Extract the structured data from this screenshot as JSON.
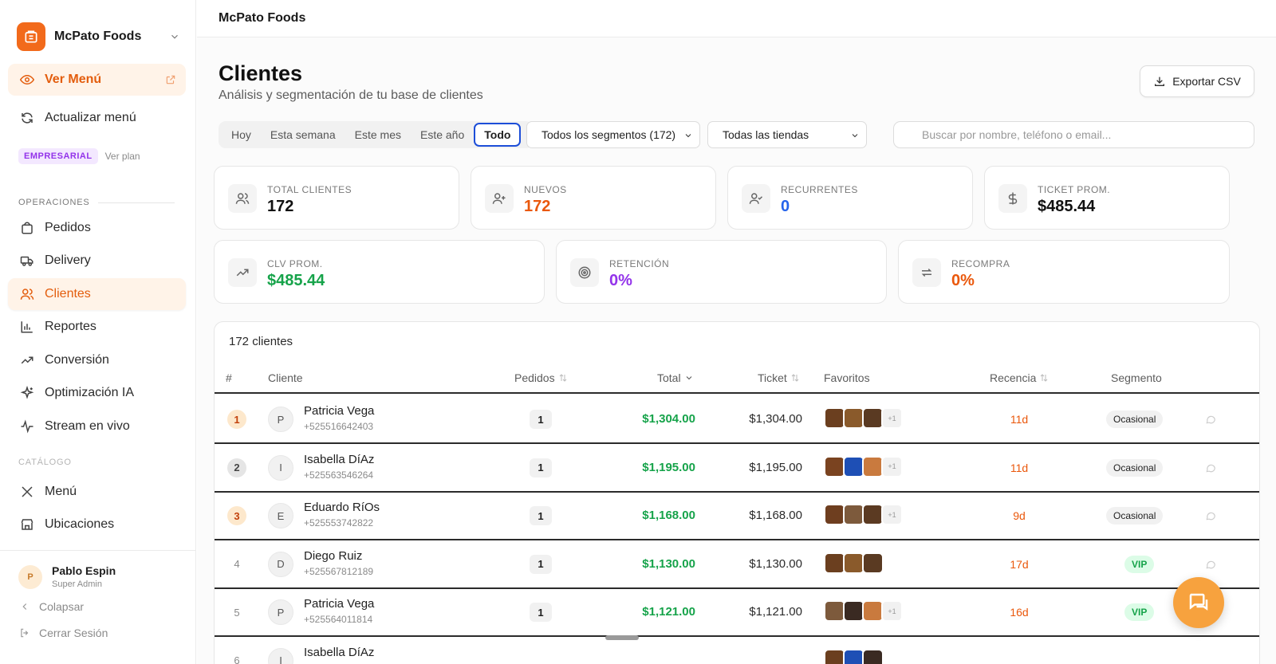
{
  "brand": {
    "name": "McPato Foods"
  },
  "sidebar": {
    "primary": [
      {
        "label": "Ver Menú",
        "icon": "eye-icon"
      },
      {
        "label": "Actualizar menú",
        "icon": "refresh-icon"
      }
    ],
    "plan": {
      "badge": "EMPRESARIAL",
      "link": "Ver plan"
    },
    "sections": [
      {
        "label": "OPERACIONES"
      },
      {
        "label": "CATÁLOGO"
      }
    ],
    "operations": [
      {
        "label": "Pedidos",
        "icon": "bag-icon"
      },
      {
        "label": "Delivery",
        "icon": "truck-icon"
      },
      {
        "label": "Clientes",
        "icon": "users-icon"
      },
      {
        "label": "Reportes",
        "icon": "bar-chart-icon"
      },
      {
        "label": "Conversión",
        "icon": "trending-up-icon"
      },
      {
        "label": "Optimización IA",
        "icon": "sparkles-icon"
      },
      {
        "label": "Stream en vivo",
        "icon": "activity-icon"
      }
    ],
    "catalog": [
      {
        "label": "Menú",
        "icon": "utensils-icon"
      },
      {
        "label": "Ubicaciones",
        "icon": "store-icon"
      }
    ],
    "user": {
      "initial": "P",
      "name": "Pablo Espin",
      "role": "Super Admin"
    },
    "collapse": "Colapsar",
    "logout": "Cerrar Sesión"
  },
  "topbar": {
    "title": "McPato Foods"
  },
  "page": {
    "title": "Clientes",
    "subtitle": "Análisis y segmentación de tu base de clientes",
    "export": "Exportar CSV"
  },
  "filters": {
    "periods": [
      "Hoy",
      "Esta semana",
      "Este mes",
      "Este año",
      "Todo"
    ],
    "active_period": "Todo",
    "segments": "Todos los segmentos (172)",
    "stores": "Todas las tiendas",
    "search_placeholder": "Buscar por nombre, teléfono o email..."
  },
  "stats": [
    {
      "label": "TOTAL CLIENTES",
      "value": "172",
      "color": "#111111",
      "icon": "users-icon"
    },
    {
      "label": "NUEVOS",
      "value": "172",
      "color": "#ea580c",
      "icon": "user-plus-icon"
    },
    {
      "label": "RECURRENTES",
      "value": "0",
      "color": "#2563eb",
      "icon": "user-check-icon"
    },
    {
      "label": "TICKET PROM.",
      "value": "$485.44",
      "color": "#111111",
      "icon": "dollar-icon"
    },
    {
      "label": "CLV PROM.",
      "value": "$485.44",
      "color": "#16a34a",
      "icon": "trending-up-icon"
    },
    {
      "label": "RETENCIÓN",
      "value": "0%",
      "color": "#9333ea",
      "icon": "target-icon"
    },
    {
      "label": "RECOMPRA",
      "value": "0%",
      "color": "#ea580c",
      "icon": "repeat-icon"
    }
  ],
  "table": {
    "count": "172 clientes",
    "headers": [
      "#",
      "Cliente",
      "Pedidos",
      "Total",
      "Ticket",
      "Favoritos",
      "Recencia",
      "Segmento"
    ],
    "rows": [
      {
        "rank": "1",
        "initial": "P",
        "name": "Patricia Vega",
        "phone": "+525516642403",
        "orders": "1",
        "total": "$1,304.00",
        "ticket": "$1,304.00",
        "favs": [
          "#6b3f1f",
          "#8a5a2b",
          "#5a3a22"
        ],
        "more": "+1",
        "recency": "11d",
        "segment": "Ocasional"
      },
      {
        "rank": "2",
        "initial": "I",
        "name": "Isabella DíAz",
        "phone": "+525563546264",
        "orders": "1",
        "total": "$1,195.00",
        "ticket": "$1,195.00",
        "favs": [
          "#7a4320",
          "#1e4fb5",
          "#c97a3e"
        ],
        "more": "+1",
        "recency": "11d",
        "segment": "Ocasional"
      },
      {
        "rank": "3",
        "initial": "E",
        "name": "Eduardo RíOs",
        "phone": "+525553742822",
        "orders": "1",
        "total": "$1,168.00",
        "ticket": "$1,168.00",
        "favs": [
          "#6e3e1f",
          "#7d5a3c",
          "#5b3a22"
        ],
        "more": "+1",
        "recency": "9d",
        "segment": "Ocasional"
      },
      {
        "rank": "4",
        "initial": "D",
        "name": "Diego Ruiz",
        "phone": "+525567812189",
        "orders": "1",
        "total": "$1,130.00",
        "ticket": "$1,130.00",
        "favs": [
          "#6b3f1f",
          "#8a5a2b",
          "#5a3a22"
        ],
        "more": "",
        "recency": "17d",
        "segment": "VIP"
      },
      {
        "rank": "5",
        "initial": "P",
        "name": "Patricia Vega",
        "phone": "+525564011814",
        "orders": "1",
        "total": "$1,121.00",
        "ticket": "$1,121.00",
        "favs": [
          "#7d5a3c",
          "#3a2a22",
          "#c97a3e"
        ],
        "more": "+1",
        "recency": "16d",
        "segment": "VIP"
      },
      {
        "rank": "6",
        "initial": "I",
        "name": "Isabella DíAz",
        "phone": "",
        "orders": "",
        "total": "",
        "ticket": "",
        "favs": [
          "#6b3f1f",
          "#1e4fb5",
          "#3a2a22"
        ],
        "more": "",
        "recency": "",
        "segment": ""
      }
    ]
  }
}
